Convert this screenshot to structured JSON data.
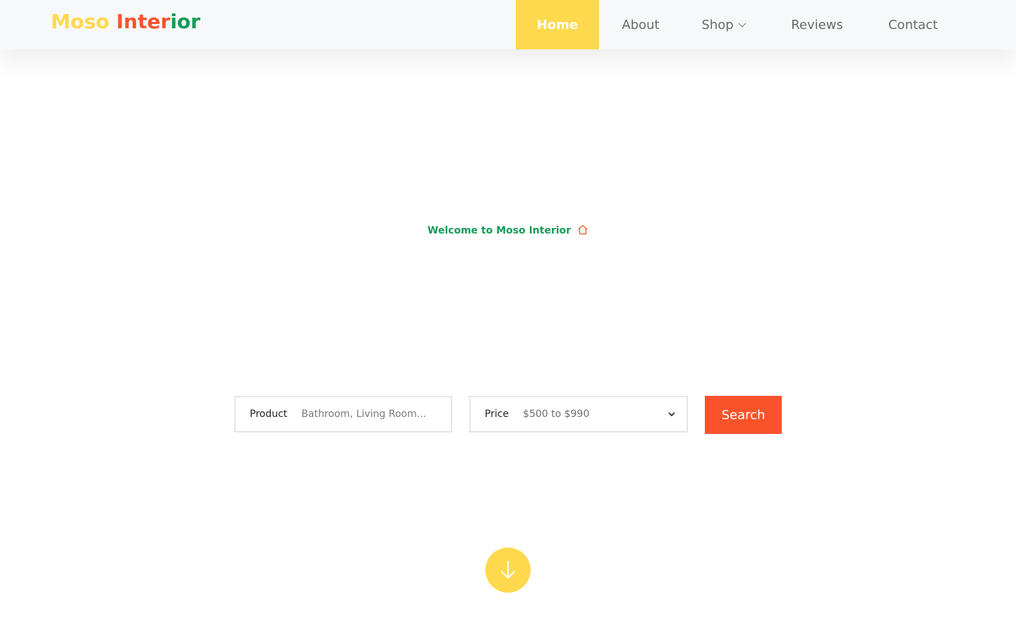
{
  "header": {
    "logo": {
      "part1": "Moso",
      "part2": "Inter",
      "part3": "ior"
    },
    "nav": [
      {
        "label": "Home",
        "active": true
      },
      {
        "label": "About"
      },
      {
        "label": "Shop",
        "icon": "chevron-down-icon"
      },
      {
        "label": "Reviews"
      },
      {
        "label": "Contact"
      }
    ]
  },
  "hero": {
    "welcome": "Welcome to Moso Interior",
    "welcome_icon": "home-icon"
  },
  "search": {
    "product_label": "Product",
    "product_placeholder": "Bathroom, Living Room...",
    "price_label": "Price",
    "price_value": "$500 to $990",
    "button_label": "Search"
  },
  "scroll": {
    "icon": "arrow-down-icon"
  },
  "colors": {
    "yellow": "#fed94e",
    "orange": "#fa532c",
    "green": "#149b59",
    "nav_text": "#666a6e",
    "header_bg": "#f7f8f9"
  }
}
